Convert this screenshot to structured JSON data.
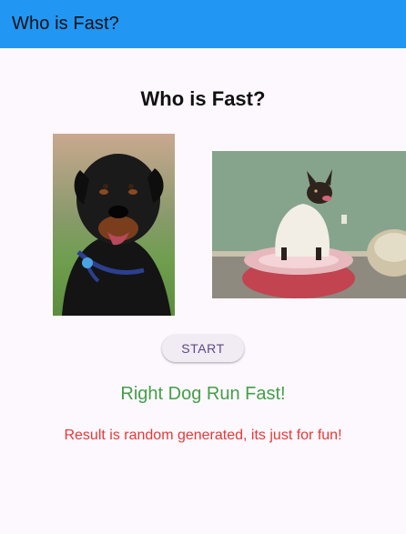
{
  "app_bar": {
    "title": "Who is Fast?",
    "color": "#2196f3"
  },
  "main": {
    "heading": "Who is Fast?",
    "left_image": {
      "subject": "rottweiler-dog-photo"
    },
    "right_image": {
      "subject": "small-dog-in-sweater-photo"
    },
    "start_button_label": "START",
    "result": "Right Dog Run Fast!",
    "result_color": "#43a047",
    "disclaimer": "Result is random generated, its just for fun!",
    "disclaimer_color": "#e53935"
  }
}
